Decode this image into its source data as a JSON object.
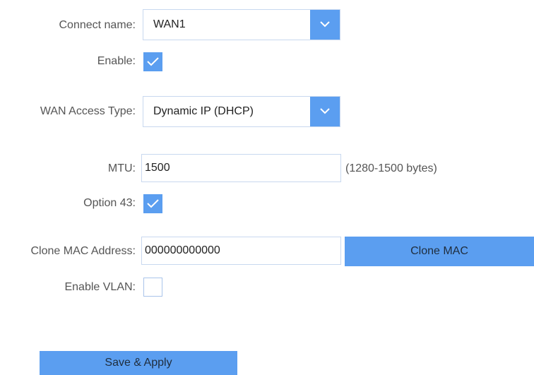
{
  "form": {
    "connect_name": {
      "label": "Connect name:",
      "value": "WAN1"
    },
    "enable": {
      "label": "Enable:",
      "checked": true
    },
    "wan_access_type": {
      "label": "WAN Access Type:",
      "value": "Dynamic IP (DHCP)"
    },
    "mtu": {
      "label": "MTU:",
      "value": "1500",
      "hint": "(1280-1500 bytes)"
    },
    "option43": {
      "label": "Option 43:",
      "checked": true
    },
    "clone_mac": {
      "label": "Clone MAC Address:",
      "value": "000000000000",
      "button_label": "Clone MAC"
    },
    "enable_vlan": {
      "label": "Enable VLAN:",
      "checked": false
    },
    "save_button_label": "Save & Apply"
  },
  "colors": {
    "accent": "#5b9ef0",
    "border": "#c8d8ef",
    "label_text": "#555555"
  }
}
